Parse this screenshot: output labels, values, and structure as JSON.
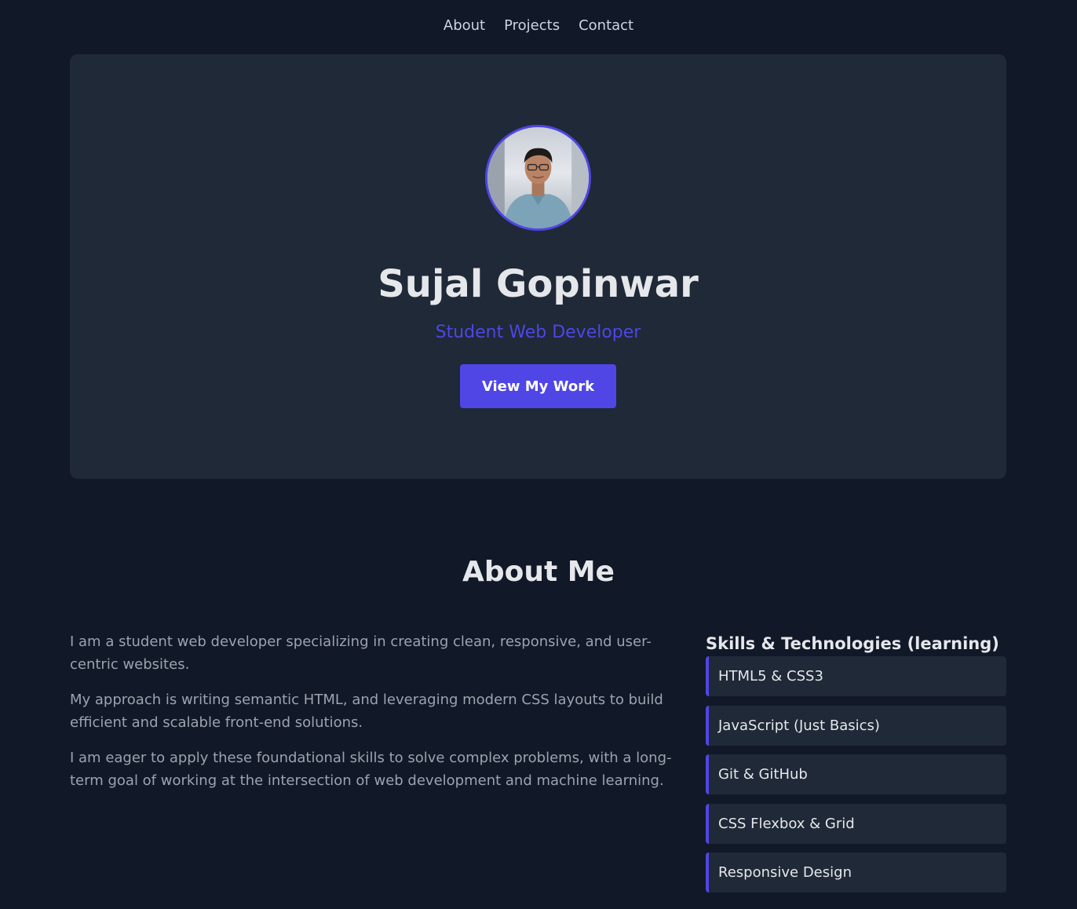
{
  "nav": {
    "items": [
      {
        "label": "About"
      },
      {
        "label": "Projects"
      },
      {
        "label": "Contact"
      }
    ]
  },
  "hero": {
    "avatar": "profile-photo",
    "name": "Sujal Gopinwar",
    "role": "Student Web Developer",
    "cta_label": "View My Work"
  },
  "about": {
    "title": "About Me",
    "paragraphs": [
      "I am a student web developer specializing in creating clean, responsive, and user-centric websites.",
      "My approach is writing semantic HTML, and leveraging modern CSS layouts to build efficient and scalable front-end solutions.",
      "I am eager to apply these foundational skills to solve complex problems, with a long-term goal of working at the intersection of web development and machine learning."
    ]
  },
  "skills": {
    "title": "Skills & Technologies (learning)",
    "items": [
      "HTML5 & CSS3",
      "JavaScript (Just Basics)",
      "Git & GitHub",
      "CSS Flexbox & Grid",
      "Responsive Design"
    ]
  },
  "colors": {
    "background": "#111827",
    "card": "#1f2937",
    "accent": "#4f46e5",
    "heading": "#e5e7eb",
    "body_text": "#9ca3af"
  }
}
